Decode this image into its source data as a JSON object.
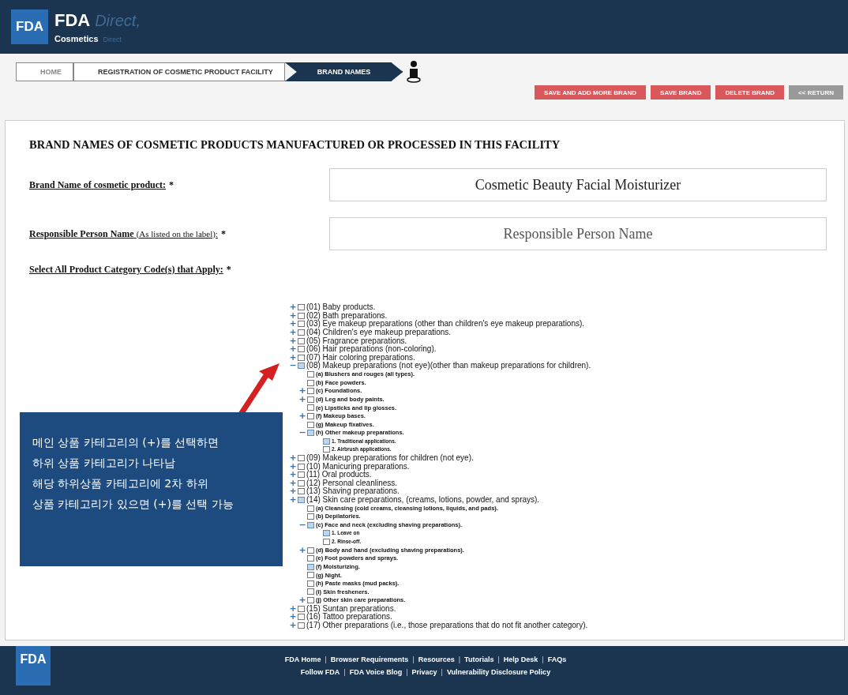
{
  "header": {
    "badge": "FDA",
    "brand": "FDA",
    "brand_suffix": "Direct,",
    "product": "Cosmetics",
    "product_suffix": "Direct"
  },
  "breadcrumb": [
    {
      "label": "HOME",
      "selected": false
    },
    {
      "label": "REGISTRATION OF COSMETIC PRODUCT FACILITY",
      "selected": false
    },
    {
      "label": "BRAND NAMES",
      "selected": true
    }
  ],
  "actions": [
    {
      "label": "SAVE AND ADD MORE BRAND",
      "kind": "danger"
    },
    {
      "label": "SAVE BRAND",
      "kind": "danger"
    },
    {
      "label": "DELETE BRAND",
      "kind": "danger"
    },
    {
      "label": "<< RETURN",
      "kind": "secondary"
    }
  ],
  "form": {
    "title": "BRAND NAMES OF COSMETIC PRODUCTS MANUFACTURED OR PROCESSED IN THIS FACILITY",
    "fields": [
      {
        "label": "Brand Name of cosmetic product:",
        "required": "*",
        "value": "Cosmetic Beauty Facial Moisturizer"
      },
      {
        "label": "Responsible Person Name",
        "note": "(As listed on the label):",
        "required": "*",
        "placeholder": "Responsible Person Name"
      }
    ],
    "category_label": "Select All Product Category Code(s) that Apply:",
    "category_required": "*",
    "categories": [
      {
        "label": "(01) Baby products.",
        "checked": false,
        "toggle": "+"
      },
      {
        "label": "(02) Bath preparations.",
        "checked": false,
        "toggle": "+"
      },
      {
        "label": "(03) Eye makeup preparations (other than children's eye makeup preparations).",
        "checked": false,
        "toggle": "+"
      },
      {
        "label": "(04) Children's eye makeup preparations.",
        "checked": false,
        "toggle": "+"
      },
      {
        "label": "(05) Fragrance preparations.",
        "checked": false,
        "toggle": "+"
      },
      {
        "label": "(06) Hair preparations (non-coloring).",
        "checked": false,
        "toggle": "+"
      },
      {
        "label": "(07) Hair coloring preparations.",
        "checked": false,
        "toggle": "+"
      },
      {
        "label": "(08) Makeup preparations (not eye)(other than makeup preparations for children).",
        "checked": true,
        "toggle": "−",
        "children": [
          {
            "label": "(a) Blushers and rouges (all types).",
            "checked": false
          },
          {
            "label": "(b) Face powders.",
            "checked": false
          },
          {
            "label": "(c) Foundations.",
            "checked": false,
            "toggle": "+"
          },
          {
            "label": "(d) Leg and body paints.",
            "checked": false,
            "toggle": "+"
          },
          {
            "label": "(e) Lipsticks and lip glosses.",
            "checked": false
          },
          {
            "label": "(f) Makeup bases.",
            "checked": false,
            "toggle": "+"
          },
          {
            "label": "(g) Makeup fixatives.",
            "checked": false
          },
          {
            "label": "(h) Other makeup preparations.",
            "checked": true,
            "toggle": "−",
            "children": [
              {
                "label": "1. Traditional applications.",
                "checked": true
              },
              {
                "label": "2. Airbrush applications.",
                "checked": false
              }
            ]
          }
        ]
      },
      {
        "label": "(09) Makeup preparations for children (not eye).",
        "checked": false,
        "toggle": "+"
      },
      {
        "label": "(10) Manicuring preparations.",
        "checked": false,
        "toggle": "+"
      },
      {
        "label": "(11) Oral products.",
        "checked": false,
        "toggle": "+"
      },
      {
        "label": "(12) Personal cleanliness.",
        "checked": false,
        "toggle": "+"
      },
      {
        "label": "(13) Shaving preparations.",
        "checked": false,
        "toggle": "+"
      },
      {
        "label": "(14) Skin care preparations, (creams, lotions, powder, and sprays).",
        "checked": true,
        "toggle": "+",
        "children": [
          {
            "label": "(a) Cleansing (cold creams, cleansing lotions, liquids, and pads).",
            "checked": false
          },
          {
            "label": "(b) Depilatories.",
            "checked": false
          },
          {
            "label": "(c) Face and neck (excluding shaving preparations).",
            "checked": true,
            "toggle": "−",
            "children": [
              {
                "label": "1. Leave on",
                "checked": true
              },
              {
                "label": "2. Rinse-off.",
                "checked": false
              }
            ]
          },
          {
            "label": "(d) Body and hand (excluding shaving preparations).",
            "checked": false,
            "toggle": "+"
          },
          {
            "label": "(e) Foot powders and sprays.",
            "checked": false
          },
          {
            "label": "(f) Moisturizing.",
            "checked": true
          },
          {
            "label": "(g) Night.",
            "checked": false
          },
          {
            "label": "(h) Paste masks (mud packs).",
            "checked": false
          },
          {
            "label": "(i) Skin fresheners.",
            "checked": false
          },
          {
            "label": "(j) Other skin care preparations.",
            "checked": false,
            "toggle": "+"
          }
        ]
      },
      {
        "label": "(15) Suntan preparations.",
        "checked": false,
        "toggle": "+"
      },
      {
        "label": "(16) Tattoo preparations.",
        "checked": false,
        "toggle": "+"
      },
      {
        "label": "(17) Other preparations (i.e., those preparations that do not fit another category).",
        "checked": false,
        "toggle": "+"
      }
    ]
  },
  "callout": {
    "lines": [
      "메인 상품 카테고리의 (+)를 선택하면",
      "하위 상품 카테고리가 나타남",
      "해당 하위상품 카테고리에 2차 하위",
      "상품 카테고리가 있으면 (+)를 선택 가능"
    ]
  },
  "footer": {
    "badge": "FDA",
    "separator": "|",
    "links": [
      [
        "FDA Home",
        "Browser Requirements",
        "Resources",
        "Tutorials",
        "Help Desk",
        "FAQs"
      ],
      [
        "Follow FDA",
        "FDA Voice Blog",
        "Privacy",
        "Vulnerability Disclosure Policy"
      ]
    ]
  }
}
